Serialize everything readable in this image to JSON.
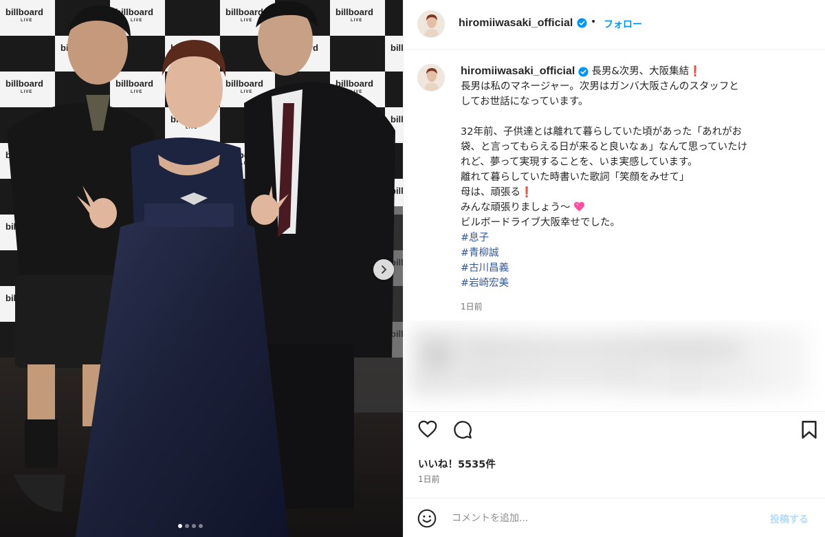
{
  "post": {
    "photo": {
      "backdrop_logo": "billboard",
      "backdrop_sub": "LIVE",
      "slide_count": 4,
      "active_slide": 1
    },
    "header": {
      "username": "hiromiiwasaki_official",
      "separator": "•",
      "follow_label": "フォロー"
    },
    "caption": {
      "username": "hiromiiwasaki_official",
      "line1": "長男&次男、大阪集結",
      "lines_a": [
        "長男は私のマネージャー。次男はガンバ大阪さんのスタッフと",
        "してお世話になっています。"
      ],
      "lines_b": [
        "32年前、子供達とは離れて暮らしていた頃があった「あれがお",
        "袋、と言ってもらえる日が来ると良いなぁ」なんて思っていたけ",
        "れど、夢って実現することを、いま実感しています。",
        "離れて暮らしていた時書いた歌詞「笑顔をみせて」"
      ],
      "line_mother": "母は、頑張る",
      "line_everyone": "みんな頑張りましょう〜",
      "line_last": "ビルボードライブ大阪幸せでした。",
      "hashtags": [
        "#息子",
        "#青柳誠",
        "#古川昌義",
        "#岩崎宏美"
      ],
      "time": "1日前"
    },
    "likes": "いいね！5535件",
    "post_time": "1日前",
    "comment": {
      "placeholder": "コメントを追加...",
      "post_label": "投稿する"
    },
    "icons": {
      "verified": "verified-badge-icon",
      "like": "heart-icon",
      "comment": "comment-bubble-icon",
      "save": "bookmark-icon",
      "emoji": "emoji-smile-icon",
      "next": "chevron-right-icon"
    },
    "colors": {
      "accent": "#0095f6",
      "hashtag": "#385898",
      "exclaim": "#e0245e",
      "heart_emoji": "#ff4fa3"
    }
  }
}
